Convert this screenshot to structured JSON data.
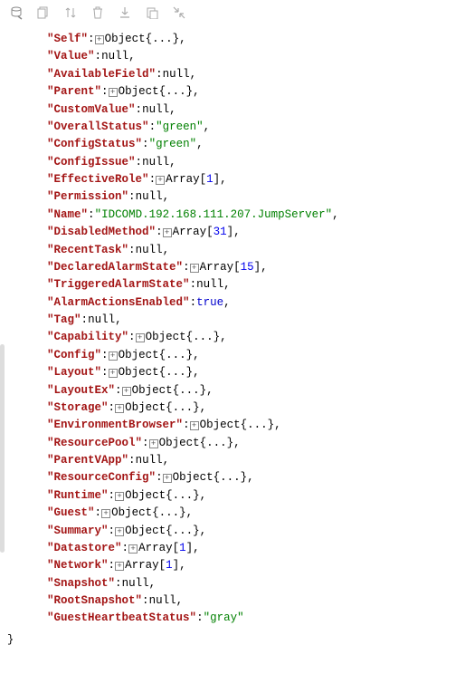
{
  "toolbar": {
    "icons": [
      "database-icon",
      "copy-icon",
      "sort-icon",
      "trash-icon",
      "download-icon",
      "clipboard-icon",
      "collapse-icon"
    ]
  },
  "labels": {
    "object": "Object",
    "objectSuffix": "{...}",
    "array": "Array",
    "nullLiteral": "null",
    "trueLiteral": "true"
  },
  "props": [
    {
      "key": "Self",
      "type": "object"
    },
    {
      "key": "Value",
      "type": "null"
    },
    {
      "key": "AvailableField",
      "type": "null"
    },
    {
      "key": "Parent",
      "type": "object"
    },
    {
      "key": "CustomValue",
      "type": "null"
    },
    {
      "key": "OverallStatus",
      "type": "string",
      "value": "green"
    },
    {
      "key": "ConfigStatus",
      "type": "string",
      "value": "green"
    },
    {
      "key": "ConfigIssue",
      "type": "null"
    },
    {
      "key": "EffectiveRole",
      "type": "array",
      "count": 1
    },
    {
      "key": "Permission",
      "type": "null"
    },
    {
      "key": "Name",
      "type": "string",
      "value": "IDCOMD.192.168.111.207.JumpServer"
    },
    {
      "key": "DisabledMethod",
      "type": "array",
      "count": 31
    },
    {
      "key": "RecentTask",
      "type": "null"
    },
    {
      "key": "DeclaredAlarmState",
      "type": "array",
      "count": 15
    },
    {
      "key": "TriggeredAlarmState",
      "type": "null"
    },
    {
      "key": "AlarmActionsEnabled",
      "type": "true"
    },
    {
      "key": "Tag",
      "type": "null"
    },
    {
      "key": "Capability",
      "type": "object"
    },
    {
      "key": "Config",
      "type": "object"
    },
    {
      "key": "Layout",
      "type": "object"
    },
    {
      "key": "LayoutEx",
      "type": "object"
    },
    {
      "key": "Storage",
      "type": "object"
    },
    {
      "key": "EnvironmentBrowser",
      "type": "object"
    },
    {
      "key": "ResourcePool",
      "type": "object"
    },
    {
      "key": "ParentVApp",
      "type": "null"
    },
    {
      "key": "ResourceConfig",
      "type": "object"
    },
    {
      "key": "Runtime",
      "type": "object"
    },
    {
      "key": "Guest",
      "type": "object"
    },
    {
      "key": "Summary",
      "type": "object"
    },
    {
      "key": "Datastore",
      "type": "array",
      "count": 1
    },
    {
      "key": "Network",
      "type": "array",
      "count": 1
    },
    {
      "key": "Snapshot",
      "type": "null"
    },
    {
      "key": "RootSnapshot",
      "type": "null"
    },
    {
      "key": "GuestHeartbeatStatus",
      "type": "string",
      "value": "gray"
    }
  ]
}
